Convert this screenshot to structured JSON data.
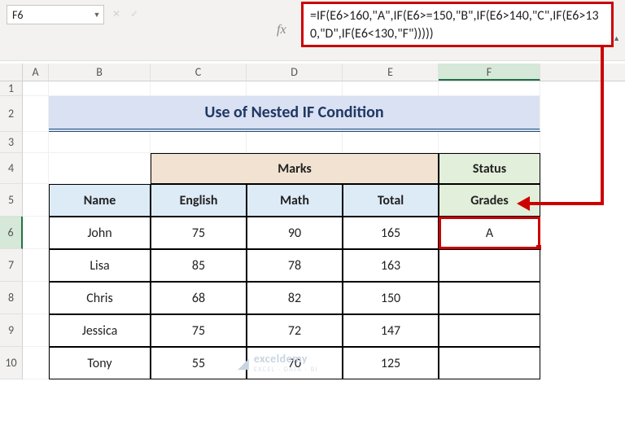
{
  "namebox": {
    "value": "F6"
  },
  "formula_bar": {
    "fx_label": "fx",
    "formula": "=IF(E6>160,\"A\",IF(E6>=150,\"B\",IF(E6>140,\"C\",IF(E6>130,\"D\",IF(E6<130,\"F\")))))"
  },
  "columns": [
    "A",
    "B",
    "C",
    "D",
    "E",
    "F"
  ],
  "selected_column": "F",
  "row_numbers": [
    1,
    2,
    3,
    4,
    5,
    6,
    7,
    8,
    9,
    10
  ],
  "selected_row": 6,
  "title": "Use of Nested IF Condition",
  "headers": {
    "marks": "Marks",
    "status": "Status",
    "name": "Name",
    "english": "English",
    "math": "Math",
    "total": "Total",
    "grades": "Grades"
  },
  "rows": [
    {
      "name": "John",
      "english": 75,
      "math": 90,
      "total": 165,
      "grade": "A"
    },
    {
      "name": "Lisa",
      "english": 85,
      "math": 78,
      "total": 163,
      "grade": ""
    },
    {
      "name": "Chris",
      "english": 68,
      "math": 82,
      "total": 150,
      "grade": ""
    },
    {
      "name": "Jessica",
      "english": 75,
      "math": 72,
      "total": 147,
      "grade": ""
    },
    {
      "name": "Tony",
      "english": 55,
      "math": 70,
      "total": 125,
      "grade": ""
    }
  ],
  "watermark": {
    "brand": "exceldemy",
    "tagline": "EXCEL · DATA · BI"
  },
  "chart_data": {
    "type": "table",
    "title": "Use of Nested IF Condition",
    "columns": [
      "Name",
      "English",
      "Math",
      "Total",
      "Grades"
    ],
    "rows": [
      [
        "John",
        75,
        90,
        165,
        "A"
      ],
      [
        "Lisa",
        85,
        78,
        163,
        ""
      ],
      [
        "Chris",
        68,
        82,
        150,
        ""
      ],
      [
        "Jessica",
        75,
        72,
        147,
        ""
      ],
      [
        "Tony",
        55,
        70,
        125,
        ""
      ]
    ]
  }
}
